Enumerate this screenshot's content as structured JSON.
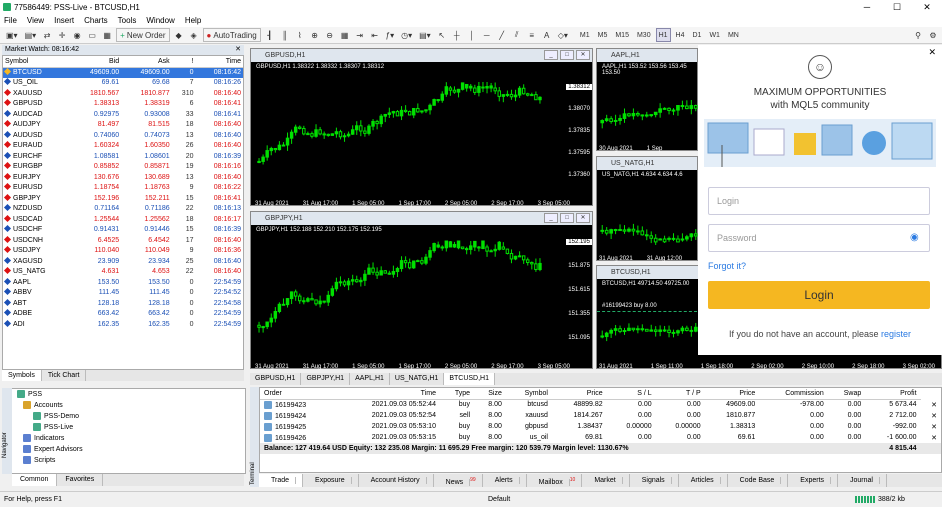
{
  "window": {
    "title": "77586449: PSS-Live - BTCUSD,H1",
    "minimize": "─",
    "maximize": "☐",
    "close": "✕"
  },
  "menu": [
    "File",
    "View",
    "Insert",
    "Charts",
    "Tools",
    "Window",
    "Help"
  ],
  "toolbar": {
    "new_order": "New Order",
    "autotrading": "AutoTrading",
    "timeframes": [
      "M1",
      "M5",
      "M15",
      "M30",
      "H1",
      "H4",
      "D1",
      "W1",
      "MN"
    ],
    "active_tf": "H1"
  },
  "market_watch": {
    "title": "Market Watch: 08:16:42",
    "columns": [
      "Symbol",
      "Bid",
      "Ask",
      "!",
      "Time"
    ],
    "rows": [
      {
        "s": "BTCUSD",
        "bid": "49609.00",
        "ask": "49609.00",
        "sp": "0",
        "t": "08:16:42",
        "dir": "up"
      },
      {
        "s": "US_OIL",
        "bid": "69.61",
        "ask": "69.68",
        "sp": "7",
        "t": "08:16:26",
        "dir": "up"
      },
      {
        "s": "XAUUSD",
        "bid": "1810.567",
        "ask": "1810.877",
        "sp": "310",
        "t": "08:16:40",
        "dir": "dn"
      },
      {
        "s": "GBPUSD",
        "bid": "1.38313",
        "ask": "1.38319",
        "sp": "6",
        "t": "08:16:41",
        "dir": "dn"
      },
      {
        "s": "AUDCAD",
        "bid": "0.92975",
        "ask": "0.93008",
        "sp": "33",
        "t": "08:16:41",
        "dir": "up"
      },
      {
        "s": "AUDJPY",
        "bid": "81.497",
        "ask": "81.515",
        "sp": "18",
        "t": "08:16:40",
        "dir": "dn"
      },
      {
        "s": "AUDUSD",
        "bid": "0.74060",
        "ask": "0.74073",
        "sp": "13",
        "t": "08:16:40",
        "dir": "up"
      },
      {
        "s": "EURAUD",
        "bid": "1.60324",
        "ask": "1.60350",
        "sp": "26",
        "t": "08:16:40",
        "dir": "dn"
      },
      {
        "s": "EURCHF",
        "bid": "1.08581",
        "ask": "1.08601",
        "sp": "20",
        "t": "08:16:39",
        "dir": "up"
      },
      {
        "s": "EURGBP",
        "bid": "0.85852",
        "ask": "0.85871",
        "sp": "19",
        "t": "08:16:16",
        "dir": "dn"
      },
      {
        "s": "EURJPY",
        "bid": "130.676",
        "ask": "130.689",
        "sp": "13",
        "t": "08:16:40",
        "dir": "dn"
      },
      {
        "s": "EURUSD",
        "bid": "1.18754",
        "ask": "1.18763",
        "sp": "9",
        "t": "08:16:22",
        "dir": "dn"
      },
      {
        "s": "GBPJPY",
        "bid": "152.196",
        "ask": "152.211",
        "sp": "15",
        "t": "08:16:41",
        "dir": "dn"
      },
      {
        "s": "NZDUSD",
        "bid": "0.71164",
        "ask": "0.71186",
        "sp": "22",
        "t": "08:16:13",
        "dir": "up"
      },
      {
        "s": "USDCAD",
        "bid": "1.25544",
        "ask": "1.25562",
        "sp": "18",
        "t": "08:16:17",
        "dir": "dn"
      },
      {
        "s": "USDCHF",
        "bid": "0.91431",
        "ask": "0.91446",
        "sp": "15",
        "t": "08:16:39",
        "dir": "up"
      },
      {
        "s": "USDCNH",
        "bid": "6.4525",
        "ask": "6.4542",
        "sp": "17",
        "t": "08:16:40",
        "dir": "dn"
      },
      {
        "s": "USDJPY",
        "bid": "110.040",
        "ask": "110.049",
        "sp": "9",
        "t": "08:16:36",
        "dir": "dn"
      },
      {
        "s": "XAGUSD",
        "bid": "23.909",
        "ask": "23.934",
        "sp": "25",
        "t": "08:16:40",
        "dir": "up"
      },
      {
        "s": "US_NATG",
        "bid": "4.631",
        "ask": "4.653",
        "sp": "22",
        "t": "08:16:40",
        "dir": "dn"
      },
      {
        "s": "AAPL",
        "bid": "153.50",
        "ask": "153.50",
        "sp": "0",
        "t": "22:54:59",
        "dir": "up"
      },
      {
        "s": "ABBV",
        "bid": "111.45",
        "ask": "111.45",
        "sp": "0",
        "t": "22:54:52",
        "dir": "up"
      },
      {
        "s": "ABT",
        "bid": "128.18",
        "ask": "128.18",
        "sp": "0",
        "t": "22:54:58",
        "dir": "up"
      },
      {
        "s": "ADBE",
        "bid": "663.42",
        "ask": "663.42",
        "sp": "0",
        "t": "22:54:59",
        "dir": "up"
      },
      {
        "s": "ADI",
        "bid": "162.35",
        "ask": "162.35",
        "sp": "0",
        "t": "22:54:59",
        "dir": "up"
      }
    ],
    "tabs": [
      "Symbols",
      "Tick Chart"
    ]
  },
  "navigator": {
    "label": "Navigator",
    "items": [
      "PSS",
      "Accounts",
      "PSS-Demo",
      "PSS-Live",
      "Indicators",
      "Expert Advisors",
      "Scripts"
    ],
    "tabs": [
      "Common",
      "Favorites"
    ]
  },
  "charts": [
    {
      "title": "GBPUSD,H1",
      "info": "GBPUSD,H1 1.38322 1.38332 1.38307 1.38312",
      "y": [
        "1.38312",
        "1.38070",
        "1.37835",
        "1.37595",
        "1.37360"
      ],
      "x": [
        "31 Aug 2021",
        "31 Aug 17:00",
        "1 Sep 05:00",
        "1 Sep 17:00",
        "2 Sep 05:00",
        "2 Sep 17:00",
        "3 Sep 05:00"
      ]
    },
    {
      "title": "GBPJPY,H1",
      "info": "GBPJPY,H1 152.188 152.210 152.175 152.195",
      "y": [
        "152.195",
        "151.875",
        "151.615",
        "151.355",
        "151.095"
      ],
      "x": [
        "31 Aug 2021",
        "31 Aug 17:00",
        "1 Sep 05:00",
        "1 Sep 17:00",
        "2 Sep 05:00",
        "2 Sep 17:00",
        "3 Sep 05:00"
      ]
    },
    {
      "title": "AAPL,H1",
      "info": "AAPL,H1 153.52 153.56 153.45 153.50",
      "x": [
        "30 Aug 2021",
        "1 Sep"
      ]
    },
    {
      "title": "US_NATG,H1",
      "info": "US_NATG,H1 4.634 4.634 4.6",
      "x": [
        "31 Aug 2021",
        "31 Aug 12:00"
      ]
    },
    {
      "title": "BTCUSD,H1",
      "info": "BTCUSD,H1 49714.50 49725.00",
      "order": "#16199423 buy 8.00",
      "x": [
        "31 Aug 2021",
        "1 Sep 11:00"
      ]
    }
  ],
  "chart_tabs": [
    "GBPUSD,H1",
    "GBPJPY,H1",
    "AAPL,H1",
    "US_NATG,H1",
    "BTCUSD,H1"
  ],
  "chart_tabs_active": "BTCUSD,H1",
  "extra_x": [
    "1 Sep 18:00",
    "2 Sep 02:00",
    "2 Sep 10:00",
    "2 Sep 18:00",
    "3 Sep 02:00"
  ],
  "login": {
    "headline": "MAXIMUM OPPORTUNITIES",
    "subline": "with MQL5 community",
    "login_ph": "Login",
    "password_ph": "Password",
    "forgot": "Forgot it?",
    "button": "Login",
    "signup_text": "If you do not have an account, please ",
    "signup_link": "register",
    "close": "✕"
  },
  "terminal": {
    "label": "Terminal",
    "columns": [
      "Order",
      "Time",
      "Type",
      "Size",
      "Symbol",
      "Price",
      "S / L",
      "T / P",
      "Price",
      "Commission",
      "Swap",
      "Profit"
    ],
    "rows": [
      [
        "16199423",
        "2021.09.03 05:52:44",
        "buy",
        "8.00",
        "btcusd",
        "48899.82",
        "0.00",
        "0.00",
        "49609.00",
        "-978.00",
        "0.00",
        "5 673.44"
      ],
      [
        "16199424",
        "2021.09.03 05:52:54",
        "sell",
        "8.00",
        "xauusd",
        "1814.267",
        "0.00",
        "0.00",
        "1810.877",
        "0.00",
        "0.00",
        "2 712.00"
      ],
      [
        "16199425",
        "2021.09.03 05:53:10",
        "buy",
        "8.00",
        "gbpusd",
        "1.38437",
        "0.00000",
        "0.00000",
        "1.38313",
        "0.00",
        "0.00",
        "-992.00"
      ],
      [
        "16199426",
        "2021.09.03 05:53:15",
        "buy",
        "8.00",
        "us_oil",
        "69.81",
        "0.00",
        "0.00",
        "69.61",
        "0.00",
        "0.00",
        "-1 600.00"
      ]
    ],
    "balance": "Balance: 127 419.64 USD  Equity: 132 235.08  Margin: 11 695.29  Free margin: 120 539.79  Margin level: 1130.67%",
    "total": "4 815.44",
    "tabs": [
      "Trade",
      "Exposure",
      "Account History",
      "News",
      "Alerts",
      "Mailbox",
      "Market",
      "Signals",
      "Articles",
      "Code Base",
      "Experts",
      "Journal"
    ],
    "news_count": "99",
    "mail_count": "10"
  },
  "status": {
    "help": "For Help, press F1",
    "profile": "Default",
    "traffic": "388/2 kb"
  },
  "colors": {
    "up": "#1a4fb5",
    "down": "#dd1111",
    "candle": "#00e000",
    "login_btn": "#f5b721"
  }
}
